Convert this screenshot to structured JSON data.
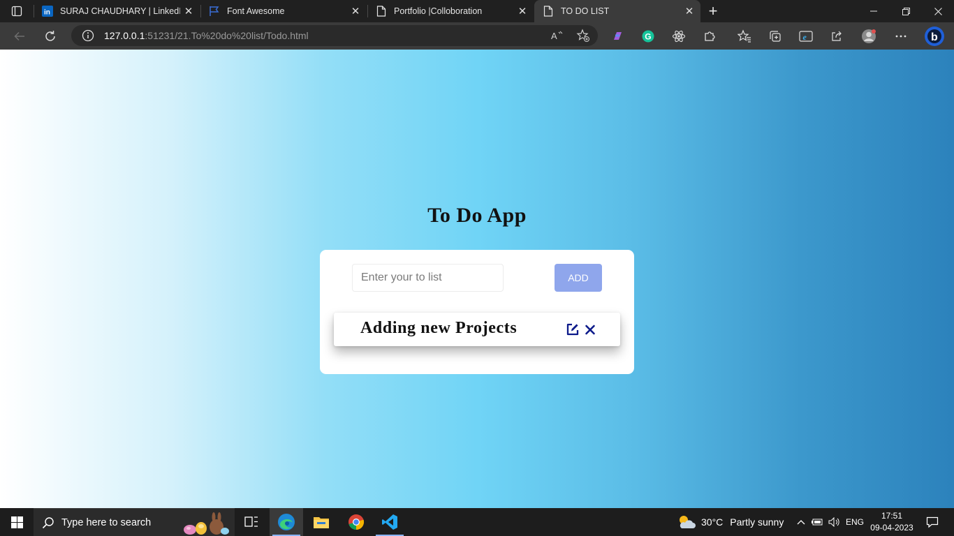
{
  "browser": {
    "tabs": [
      {
        "label": "SURAJ CHAUDHARY | LinkedIn",
        "icon": "linkedin-icon",
        "active": false
      },
      {
        "label": "Font Awesome",
        "icon": "font-awesome-flag-icon",
        "active": false
      },
      {
        "label": "Portfolio |Colloboration",
        "icon": "page-icon",
        "active": false
      },
      {
        "label": "TO DO LIST",
        "icon": "page-icon",
        "active": true
      }
    ],
    "address": {
      "host": "127.0.0.1",
      "rest": ":51231/21.To%20do%20list/Todo.html"
    },
    "colors": {
      "tab_bg": "#202020",
      "toolbar_bg": "#3b3b3b",
      "omnibox_bg": "#2a2a2a"
    }
  },
  "page": {
    "title": "To Do App",
    "input": {
      "placeholder": "Enter your to list",
      "value": ""
    },
    "add_label": "ADD",
    "items": [
      {
        "text": "Adding new Projects"
      }
    ],
    "colors": {
      "gradient": [
        "#ffffff",
        "#70d4f6",
        "#2c82bc"
      ],
      "add_button": "#8fa6ec",
      "action_icons": "#0c1a8a"
    }
  },
  "taskbar": {
    "search_placeholder": "Type here to search",
    "apps": [
      "task-view-icon",
      "edge-icon",
      "file-explorer-icon",
      "chrome-icon",
      "vscode-icon"
    ],
    "weather": {
      "temp": "30°C",
      "condition": "Partly sunny"
    },
    "language": "ENG",
    "time": "17:51",
    "date": "09-04-2023"
  }
}
